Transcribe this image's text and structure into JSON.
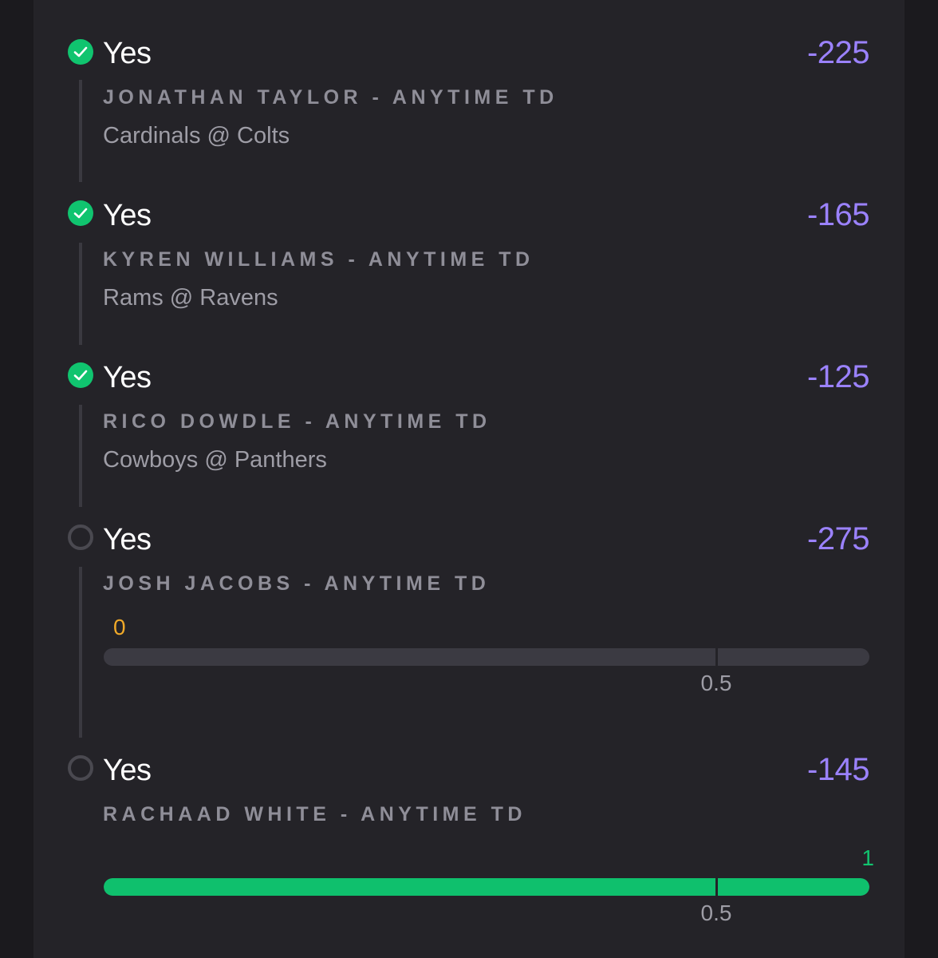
{
  "legs": [
    {
      "status": "won",
      "pick": "Yes",
      "odds": "-225",
      "market": "JONATHAN TAYLOR - ANYTIME TD",
      "game": "Cardinals @ Colts"
    },
    {
      "status": "won",
      "pick": "Yes",
      "odds": "-165",
      "market": "KYREN WILLIAMS - ANYTIME TD",
      "game": "Rams @ Ravens"
    },
    {
      "status": "won",
      "pick": "Yes",
      "odds": "-125",
      "market": "RICO DOWDLE - ANYTIME TD",
      "game": "Cowboys @ Panthers"
    },
    {
      "status": "pending",
      "pick": "Yes",
      "odds": "-275",
      "market": "JOSH JACOBS - ANYTIME TD",
      "progress": {
        "current": "0",
        "threshold": "0.5",
        "max": 0.625,
        "value": 0
      }
    },
    {
      "status": "pending",
      "pick": "Yes",
      "odds": "-145",
      "market": "RACHAAD WHITE - ANYTIME TD",
      "progress": {
        "current": "1",
        "threshold": "0.5",
        "max": 0.625,
        "value": 1
      }
    }
  ],
  "colors": {
    "accent_odds": "#9b82ff",
    "won": "#10c46f",
    "pending_ring": "#4a4950",
    "zero_value": "#f0a928",
    "card_bg": "#242328",
    "page_bg": "#1b1a1e"
  },
  "icons": {
    "won": "check-circle-icon",
    "pending": "empty-circle-icon"
  }
}
